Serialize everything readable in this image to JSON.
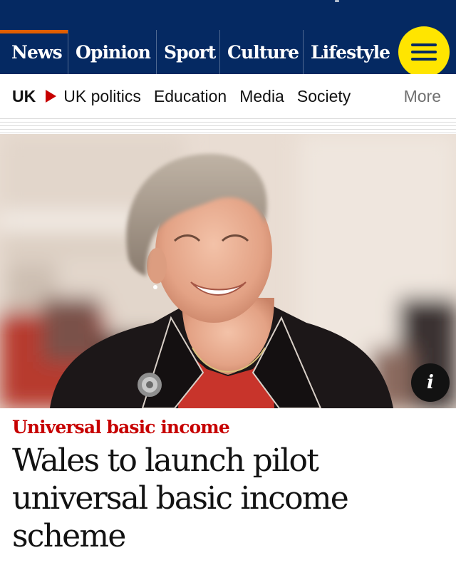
{
  "nav": {
    "pillars": [
      "News",
      "Opinion",
      "Sport",
      "Culture",
      "Lifestyle"
    ],
    "active_pillar": "News",
    "menu_icon": "hamburger-menu-icon"
  },
  "subnav": {
    "section": "UK",
    "links": [
      "UK politics",
      "Education",
      "Media",
      "Society"
    ],
    "more": "More"
  },
  "article": {
    "image_info_icon": "i",
    "kicker": "Universal basic income",
    "headline": "Wales to launch pilot universal basic income scheme"
  },
  "colors": {
    "brand": "#052962",
    "menu_yellow": "#ffe500",
    "news_red": "#c70000",
    "active_pillar": "#e05e00"
  }
}
